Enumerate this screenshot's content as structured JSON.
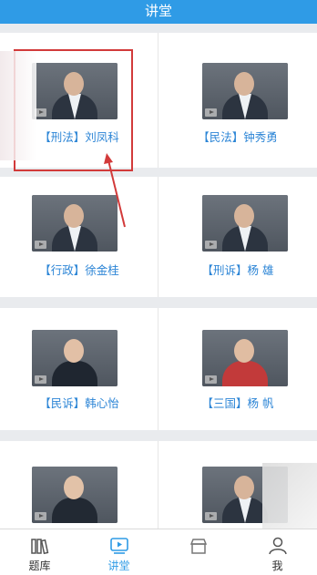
{
  "header": {
    "title": "讲堂"
  },
  "lectures": [
    {
      "label": "【刑法】刘凤科"
    },
    {
      "label": "【民法】钟秀勇"
    },
    {
      "label": "【行政】徐金桂"
    },
    {
      "label": "【刑诉】杨 雄"
    },
    {
      "label": "【民诉】韩心怡"
    },
    {
      "label": "【三国】杨 帆"
    },
    {
      "label": ""
    },
    {
      "label": ""
    }
  ],
  "tabbar": {
    "items": [
      {
        "label": "题库",
        "icon": "books-icon"
      },
      {
        "label": "讲堂",
        "icon": "video-play-icon",
        "active": true
      },
      {
        "label": "",
        "icon": "shop-icon"
      },
      {
        "label": "我",
        "icon": "user-icon"
      }
    ]
  },
  "colors": {
    "header": "#2f9be6",
    "label": "#2c85d6",
    "highlight": "#d23a3a"
  }
}
